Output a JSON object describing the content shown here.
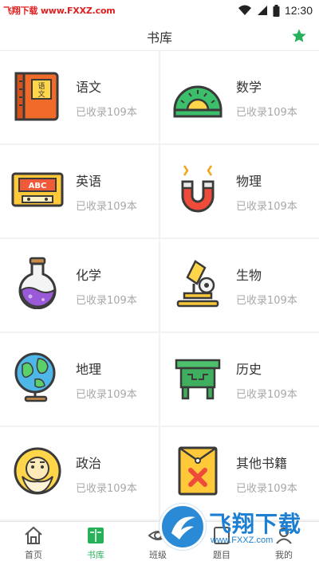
{
  "status_bar": {
    "watermark": "飞翔下载 www.FXXZ.com",
    "time": "12:30"
  },
  "header": {
    "title": "书库",
    "star_icon": "star-icon"
  },
  "subjects": [
    {
      "title": "语文",
      "count": "已收录109本",
      "icon": "chinese-book-icon"
    },
    {
      "title": "数学",
      "count": "已收录109本",
      "icon": "protractor-icon"
    },
    {
      "title": "英语",
      "count": "已收录109本",
      "icon": "abc-cassette-icon"
    },
    {
      "title": "物理",
      "count": "已收录109本",
      "icon": "magnet-icon"
    },
    {
      "title": "化学",
      "count": "已收录109本",
      "icon": "flask-icon"
    },
    {
      "title": "生物",
      "count": "已收录109本",
      "icon": "microscope-icon"
    },
    {
      "title": "地理",
      "count": "已收录109本",
      "icon": "globe-icon"
    },
    {
      "title": "历史",
      "count": "已收录109本",
      "icon": "bronze-vessel-icon"
    },
    {
      "title": "政治",
      "count": "已收录109本",
      "icon": "marx-portrait-icon"
    },
    {
      "title": "其他书籍",
      "count": "已收录109本",
      "icon": "envelope-icon"
    }
  ],
  "bottom_nav": [
    {
      "label": "首页",
      "icon": "home-icon",
      "active": false
    },
    {
      "label": "书库",
      "icon": "library-book-icon",
      "active": true
    },
    {
      "label": "班级",
      "icon": "eye-icon",
      "active": false
    },
    {
      "label": "题目",
      "icon": "question-icon",
      "active": false
    },
    {
      "label": "我的",
      "icon": "profile-icon",
      "active": false
    }
  ],
  "brand_overlay": {
    "name": "飞翔下载",
    "url": "www.FXXZ.com"
  },
  "colors": {
    "accent_green": "#28b05b",
    "count_gray": "#a8a8a8",
    "brand_blue": "#1d7fd2"
  }
}
